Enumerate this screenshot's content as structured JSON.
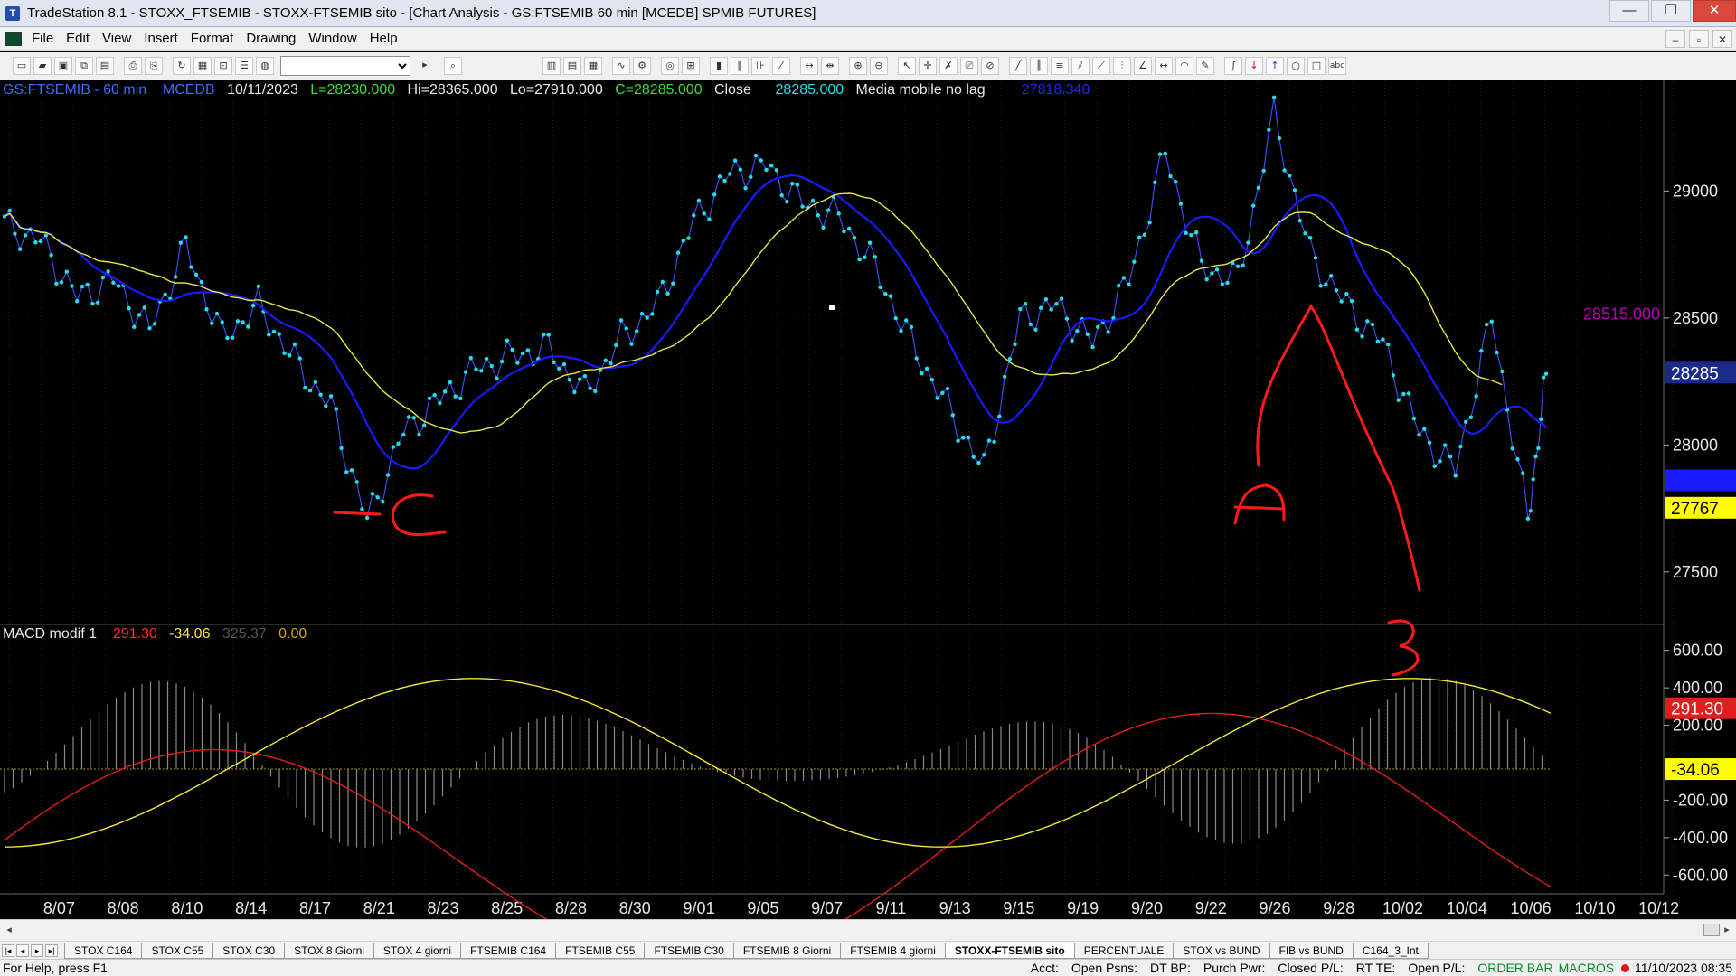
{
  "window": {
    "title": "TradeStation 8.1 - STOXX_FTSEMIB - STOXX-FTSEMIB sito - [Chart Analysis - GS:FTSEMIB  60 min  [MCEDB] SPMIB FUTURES]",
    "minimize_glyph": "—",
    "restore_glyph": "❐",
    "close_glyph": "✕"
  },
  "menu": [
    "File",
    "Edit",
    "View",
    "Insert",
    "Format",
    "Drawing",
    "Window",
    "Help"
  ],
  "mdi_buttons": [
    "–",
    "▫",
    "✕"
  ],
  "toolbar": {
    "dropdown_value": "",
    "icons_left": [
      "new-icon",
      "open-icon",
      "save-icon",
      "copy-icon",
      "paste-icon",
      "print-icon",
      "print-preview-icon",
      "lock-icon",
      "properties-icon",
      "color-icon"
    ],
    "icons_right": [
      "zoom-in-icon",
      "zoom-out-icon",
      "pointer-icon",
      "trendline-icon",
      "hline-icon",
      "vline-icon",
      "fib-icon",
      "arc-icon",
      "pencil-icon",
      "arrow-up-icon",
      "arrow-down-icon",
      "circle-icon",
      "rect-icon",
      "text-icon"
    ]
  },
  "chart": {
    "info_top": {
      "symbol": "GS:FTSEMIB - 60 min",
      "datafeed": "MCEDB",
      "date": "10/11/2023",
      "low_last": "L=28230.000",
      "hi": "Hi=28365.000",
      "lo": "Lo=27910.000",
      "close_c": "C=28285.000",
      "close_label": "Close",
      "close_val": "28285.000",
      "study": "Media mobile no lag",
      "study_val": "27818.340"
    },
    "info_macd": {
      "name": "MACD modif 1",
      "v1": "291.30",
      "v2": "-34.06",
      "v3": "325.37",
      "v4": "0.00"
    },
    "price_axis_ticks": [
      "29000",
      "28500",
      "28000",
      "27500"
    ],
    "price_axis_values": [
      29000,
      28500,
      28000,
      27500
    ],
    "price_tags": {
      "level_line": "28515.000",
      "last": "28285",
      "ma_blue": "27818.3",
      "ma_yellow": "27767"
    },
    "macd_axis_ticks": [
      "600.00",
      "400.00",
      "200.00",
      "-200.00",
      "-400.00",
      "-600.00"
    ],
    "macd_axis_values": [
      600,
      400,
      200,
      -200,
      -400,
      -600
    ],
    "macd_tags": {
      "macd": "291.30",
      "signal": "-34.06"
    },
    "date_ticks": [
      "8/07",
      "8/08",
      "8/10",
      "8/14",
      "8/17",
      "8/21",
      "8/23",
      "8/25",
      "8/28",
      "8/30",
      "9/01",
      "9/05",
      "9/07",
      "9/11",
      "9/13",
      "9/15",
      "9/19",
      "9/20",
      "9/22",
      "9/26",
      "9/28",
      "10/02",
      "10/04",
      "10/06",
      "10/10",
      "10/12"
    ],
    "annotations": [
      "LC",
      "A",
      "B"
    ],
    "colors": {
      "price": "#23e0e8",
      "ma_fast": "#1a1aff",
      "ma_slow": "#e6e64a",
      "macd": "#e01e1e",
      "signal": "#f5e83a",
      "hist": "#8a8a8a",
      "level": "#b400b4",
      "annot": "#ff1a1a"
    }
  },
  "chart_data": {
    "type": "line",
    "price_series_x_index": [
      0,
      4,
      8,
      12,
      16,
      20,
      24,
      28,
      32,
      36,
      40,
      44,
      48,
      52,
      56,
      60,
      64,
      68,
      72,
      76,
      80,
      84,
      88,
      92,
      96,
      100,
      104,
      108,
      112,
      116,
      120,
      124,
      128,
      132,
      136,
      140,
      144,
      148,
      152,
      156,
      160,
      164,
      168,
      170
    ],
    "price_series_y": [
      28870,
      28800,
      28580,
      28650,
      28450,
      28780,
      28420,
      28550,
      28330,
      28150,
      27700,
      28050,
      28180,
      28300,
      28350,
      28380,
      28200,
      28420,
      28550,
      28880,
      29070,
      29100,
      28950,
      28900,
      28700,
      28400,
      28150,
      27900,
      28500,
      28550,
      28400,
      28650,
      29150,
      28700,
      28650,
      29300,
      28750,
      28550,
      28400,
      28050,
      27900,
      28500,
      27700,
      28280
    ],
    "ylim": [
      27300,
      29400
    ],
    "macd_ylim": [
      -700,
      700
    ]
  },
  "tabs": [
    "STOX C164",
    "STOX C55",
    "STOX  C30",
    "STOX  8 Giorni",
    "STOX 4 giorni",
    "FTSEMIB C164",
    "FTSEMIB C55",
    "FTSEMIB C30",
    "FTSEMIB  8 Giorni",
    "FTSEMIB  4 giorni",
    "STOXX-FTSEMIB sito",
    "PERCENTUALE",
    "STOX vs BUND",
    "FIB vs BUND",
    "C164_3_Int"
  ],
  "active_tab": "STOXX-FTSEMIB sito",
  "status": {
    "help": "For Help, press F1",
    "acct": "Acct:",
    "open_psns": "Open Psns:",
    "dt_bp": "DT BP:",
    "purch_pwr": "Purch Pwr:",
    "closed_pl": "Closed P/L:",
    "rt_te": "RT TE:",
    "open_pl": "Open P/L:",
    "order_bar": "ORDER BAR",
    "macros": "MACROS",
    "datetime": "11/10/2023 08:35"
  }
}
